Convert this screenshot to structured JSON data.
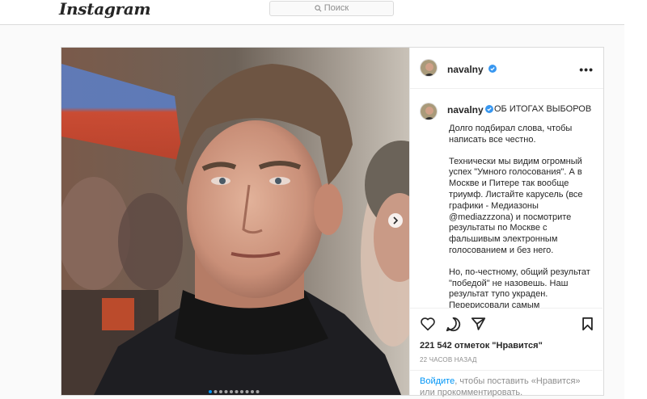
{
  "topbar": {
    "logo": "Instagram",
    "search_placeholder": "Поиск"
  },
  "post": {
    "username": "navalny",
    "verified": true,
    "more_icon": "more-horizontal-icon",
    "caption_title": "ОБ ИТОГАХ ВЫБОРОВ",
    "caption_paragraphs": [
      "Долго подбирал слова, чтобы написать все честно.",
      "Технически мы видим огромный успех \"Умного голосования\". А в Москве и Питере так вообще триумф. Листайте карусель (все графики - Медиазоны @mediazzzona) и посмотрите результаты по Москве с фальшивым электронным голосованием и без него.",
      "Но, по-честному, общий результат \"победой\" не назовешь. Наш результат тупо украден. Перерисовали самым примитивным образом."
    ],
    "likes_text": "221 542 отметок \"Нравится\"",
    "time_ago": "22 ЧАСОВ НАЗАД",
    "login_link": "Войдите",
    "login_rest": ", чтобы поставить «Нравится» или прокомментировать.",
    "carousel": {
      "total": 10,
      "active": 0
    },
    "icons": [
      "heart-icon",
      "comment-icon",
      "share-icon",
      "bookmark-icon"
    ]
  },
  "colors": {
    "accent": "#0095f6",
    "verified": "#3897f0",
    "border": "#dbdbdb",
    "secondary_text": "#8e8e8e"
  }
}
